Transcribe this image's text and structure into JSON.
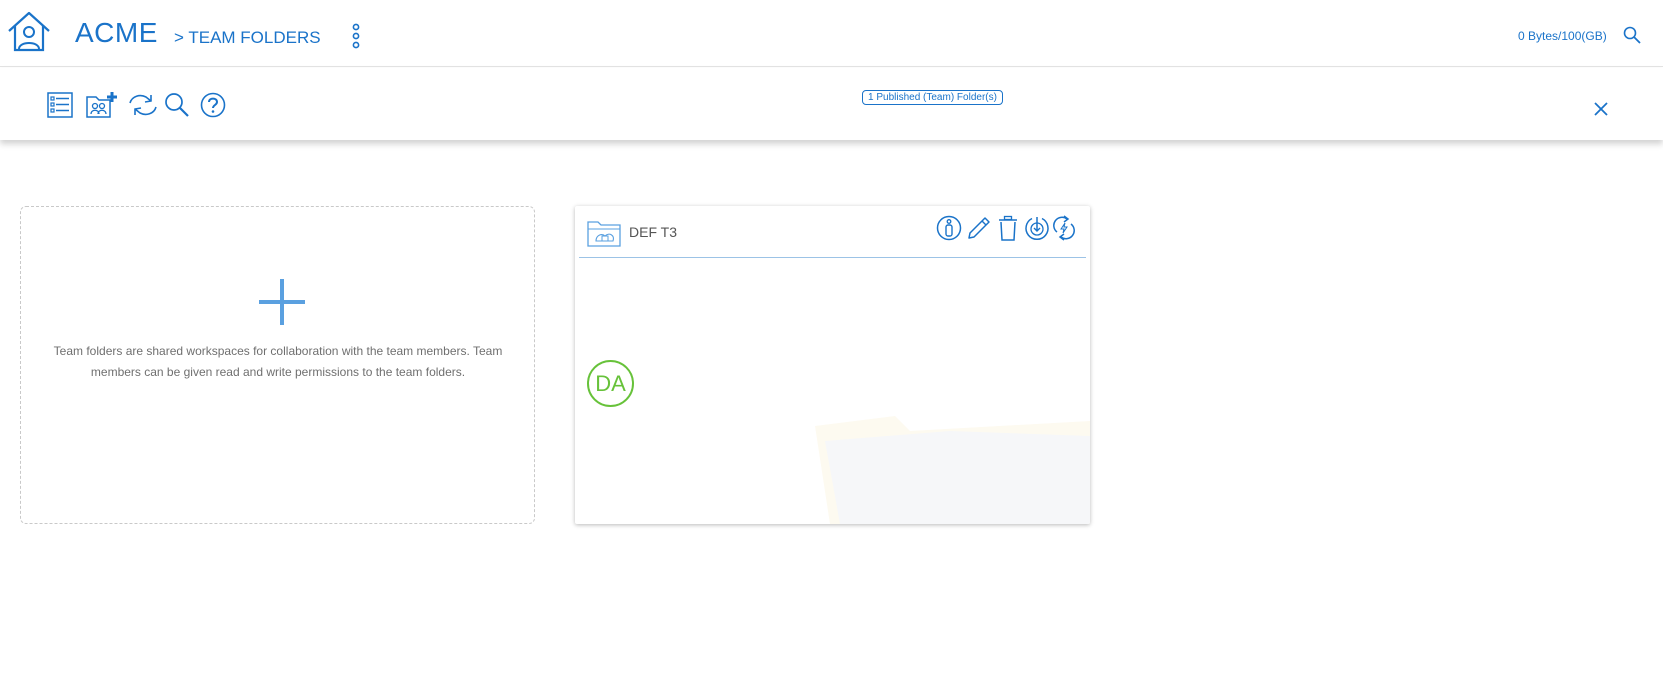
{
  "header": {
    "brand": "ACME",
    "breadcrumb": "> TEAM FOLDERS",
    "quota": "0 Bytes/100(GB)"
  },
  "toolbar": {
    "icons": [
      "list-view-icon",
      "add-team-folder-icon",
      "sync-icon",
      "search-icon",
      "help-icon"
    ],
    "published_badge": "1 Published (Team) Folder(s)"
  },
  "add_card": {
    "description": "Team folders are shared workspaces for collaboration with the team members. Team members can be given read and write permissions to the team folders."
  },
  "folders": [
    {
      "name": "DEF T3",
      "actions": [
        "info-icon",
        "edit-icon",
        "delete-icon",
        "download-icon",
        "sync-icon"
      ],
      "members": [
        "DA"
      ]
    }
  ],
  "colors": {
    "accent": "#1a73c9",
    "plus": "#5aa0e0",
    "avatar": "#67c23a"
  }
}
